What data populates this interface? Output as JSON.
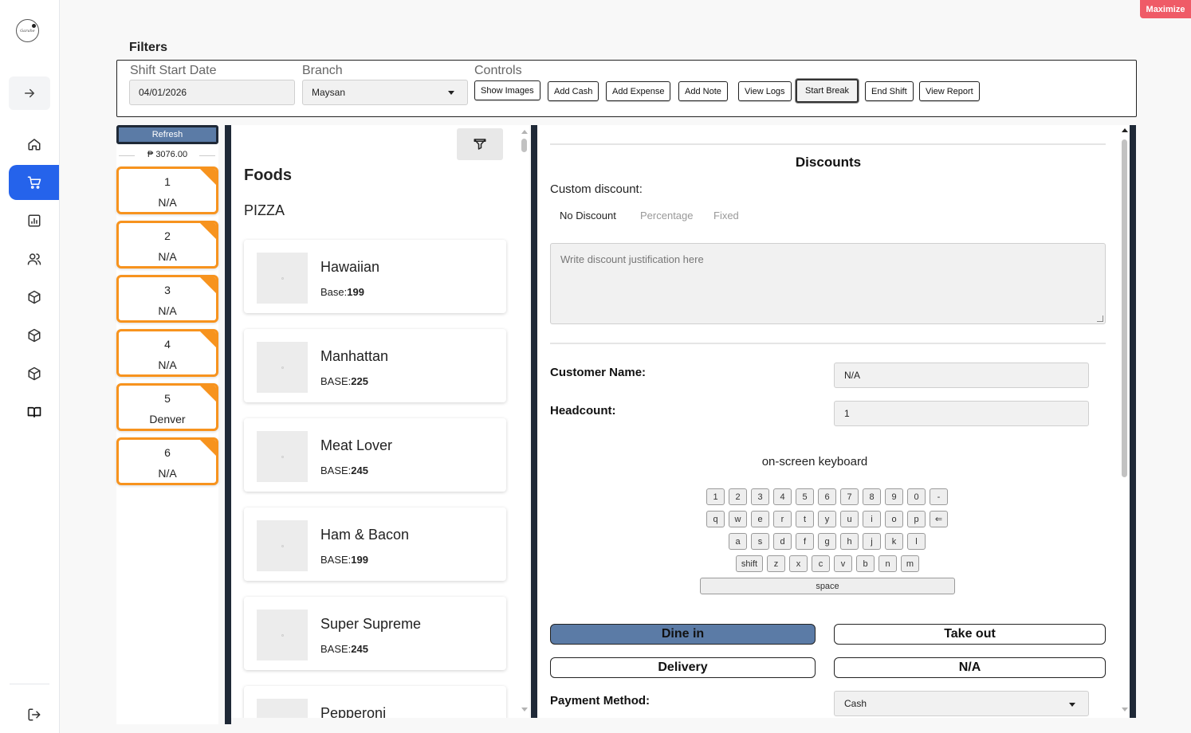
{
  "window": {
    "maximize_label": "Maximize"
  },
  "sidebar": {
    "logo_text": "Garahe",
    "items": [
      {
        "icon": "home-icon",
        "name": "nav-home"
      },
      {
        "icon": "cart-icon",
        "name": "nav-pos",
        "active": true
      },
      {
        "icon": "bar-chart-icon",
        "name": "nav-reports"
      },
      {
        "icon": "users-icon",
        "name": "nav-users"
      },
      {
        "icon": "box-icon",
        "name": "nav-inventory-1"
      },
      {
        "icon": "box-icon",
        "name": "nav-inventory-2"
      },
      {
        "icon": "box-icon",
        "name": "nav-inventory-3"
      },
      {
        "icon": "book-icon",
        "name": "nav-menu-book"
      }
    ]
  },
  "filters": {
    "title": "Filters",
    "shift_start_label": "Shift Start Date",
    "shift_start_value": "04/01/2026",
    "branch_label": "Branch",
    "branch_value": "Maysan",
    "controls_label": "Controls",
    "controls": [
      "Show Images",
      "Add Cash",
      "Add Expense",
      "Add Note",
      "View Logs",
      "Start Break",
      "End Shift",
      "View Report"
    ]
  },
  "tables": {
    "refresh_label": "Refresh",
    "total": "₱ 3076.00",
    "items": [
      {
        "number": "1",
        "customer": "N/A"
      },
      {
        "number": "2",
        "customer": "N/A"
      },
      {
        "number": "3",
        "customer": "N/A"
      },
      {
        "number": "4",
        "customer": "N/A"
      },
      {
        "number": "5",
        "customer": "Denver"
      },
      {
        "number": "6",
        "customer": "N/A"
      }
    ]
  },
  "foods": {
    "title": "Foods",
    "category": "PIZZA",
    "items": [
      {
        "name": "Hawaiian",
        "price_label": "Base:",
        "price": "199"
      },
      {
        "name": "Manhattan",
        "price_label": "BASE:",
        "price": "225"
      },
      {
        "name": "Meat Lover",
        "price_label": "BASE:",
        "price": "245"
      },
      {
        "name": "Ham & Bacon",
        "price_label": "BASE:",
        "price": "199"
      },
      {
        "name": "Super Supreme",
        "price_label": "BASE:",
        "price": "245"
      },
      {
        "name": "Pepperoni",
        "price_label": "",
        "price": ""
      }
    ]
  },
  "order": {
    "discounts_title": "Discounts",
    "custom_discount_label": "Custom discount:",
    "discount_options": [
      "No Discount",
      "Percentage",
      "Fixed"
    ],
    "justification_placeholder": "Write discount justification here",
    "customer_name_label": "Customer Name:",
    "customer_name_value": "N/A",
    "headcount_label": "Headcount:",
    "headcount_value": "1",
    "keyboard_label": "on-screen keyboard",
    "keyboard_rows": [
      [
        "1",
        "2",
        "3",
        "4",
        "5",
        "6",
        "7",
        "8",
        "9",
        "0",
        "-"
      ],
      [
        "q",
        "w",
        "e",
        "r",
        "t",
        "y",
        "u",
        "i",
        "o",
        "p",
        "⇐"
      ],
      [
        "a",
        "s",
        "d",
        "f",
        "g",
        "h",
        "j",
        "k",
        "l"
      ],
      [
        "shift",
        "z",
        "x",
        "c",
        "v",
        "b",
        "n",
        "m"
      ],
      [
        "space"
      ]
    ],
    "order_types": [
      "Dine in",
      "Take out",
      "Delivery",
      "N/A"
    ],
    "payment_label": "Payment Method:",
    "payment_value": "Cash"
  },
  "colors": {
    "accent": "#2563eb",
    "table_border": "#f7931e",
    "selected_button": "#5b7ba6",
    "maximize": "#ef5b67"
  }
}
